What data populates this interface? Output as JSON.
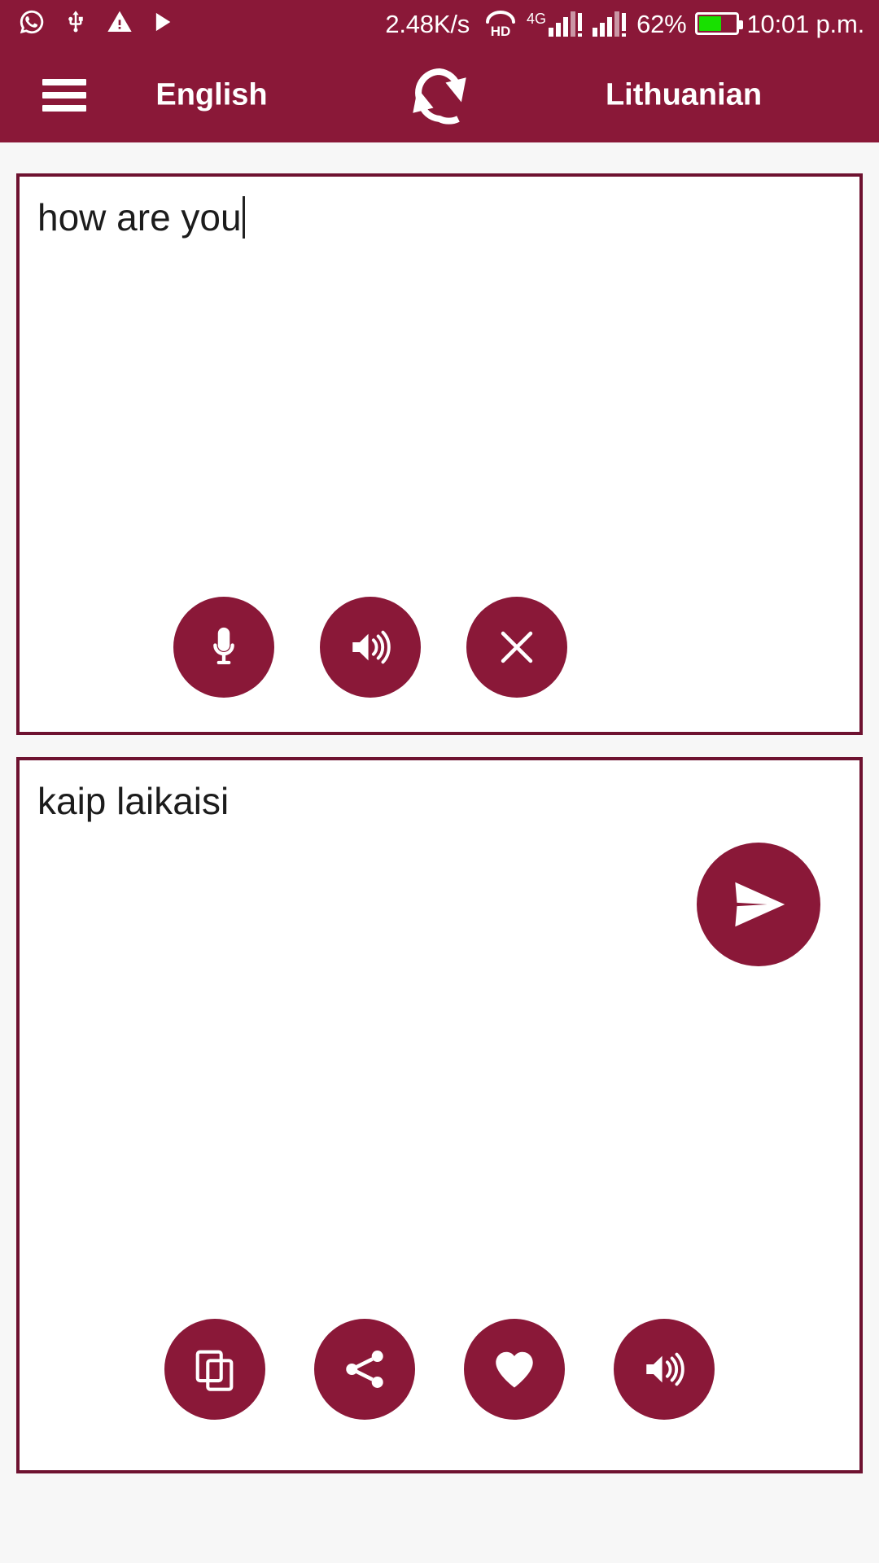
{
  "theme": {
    "primary": "#8A1838",
    "border": "#6E1230",
    "page_background": "#f7f7f7",
    "panel_background": "#ffffff",
    "battery_fill": "#18E000",
    "text": "#1c1c1c"
  },
  "status_bar": {
    "left_icons": [
      {
        "name": "whatsapp-icon",
        "label": "whatsapp"
      },
      {
        "name": "usb-icon",
        "label": "usb"
      },
      {
        "name": "warning-icon",
        "label": "warning"
      },
      {
        "name": "play-store-icon",
        "label": "play-store"
      }
    ],
    "network_speed": "2.48K/s",
    "hd_label": "HD",
    "network_type": "4G",
    "battery_percent": "62%",
    "battery_level": 62,
    "time": "10:01 p.m."
  },
  "app_bar": {
    "menu_icon": "hamburger-menu-icon",
    "source_language": "English",
    "target_language": "Lithuanian",
    "swap_icon": "swap-languages-icon"
  },
  "source_panel": {
    "text": "how are you",
    "has_caret": true,
    "buttons": [
      {
        "name": "mic-button",
        "icon": "microphone-icon",
        "label": "Speak"
      },
      {
        "name": "speak-source-button",
        "icon": "speaker-icon",
        "label": "Listen"
      },
      {
        "name": "clear-button",
        "icon": "close-icon",
        "label": "Clear"
      }
    ]
  },
  "send_button": {
    "name": "translate-send-button",
    "icon": "send-icon",
    "label": "Translate"
  },
  "target_panel": {
    "text": "kaip laikaisi",
    "buttons": [
      {
        "name": "copy-button",
        "icon": "copy-icon",
        "label": "Copy"
      },
      {
        "name": "share-button",
        "icon": "share-icon",
        "label": "Share"
      },
      {
        "name": "favorite-button",
        "icon": "heart-icon",
        "label": "Favorite"
      },
      {
        "name": "speak-target-button",
        "icon": "speaker-icon",
        "label": "Listen"
      }
    ]
  }
}
